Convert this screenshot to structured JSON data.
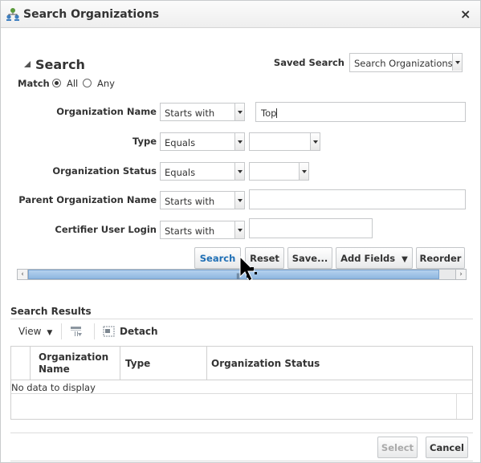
{
  "dialog": {
    "title": "Search Organizations",
    "close_label": "×"
  },
  "search": {
    "heading": "Search",
    "match_label": "Match",
    "match_all": "All",
    "match_any": "Any",
    "match_selected": "All",
    "saved_search_label": "Saved Search",
    "saved_search_value": "Search Organizations",
    "fields": [
      {
        "label": "Organization Name",
        "operator": "Starts with",
        "value": "Top"
      },
      {
        "label": "Type",
        "operator": "Equals",
        "value": ""
      },
      {
        "label": "Organization Status",
        "operator": "Equals",
        "value": ""
      },
      {
        "label": "Parent Organization Name",
        "operator": "Starts with",
        "value": ""
      },
      {
        "label": "Certifier User Login",
        "operator": "Starts with",
        "value": ""
      }
    ],
    "buttons": {
      "search": "Search",
      "reset": "Reset",
      "save": "Save...",
      "add_fields": "Add Fields",
      "reorder": "Reorder"
    }
  },
  "results": {
    "title": "Search Results",
    "view_label": "View",
    "detach_label": "Detach",
    "columns": [
      "Organization Name",
      "Type",
      "Organization Status"
    ],
    "empty_text": "No data to display"
  },
  "footer": {
    "select_label": "Select",
    "cancel_label": "Cancel"
  },
  "colors": {
    "primary_button_text": "#1f6fb5",
    "scroll_thumb": "#8fb7e0"
  }
}
